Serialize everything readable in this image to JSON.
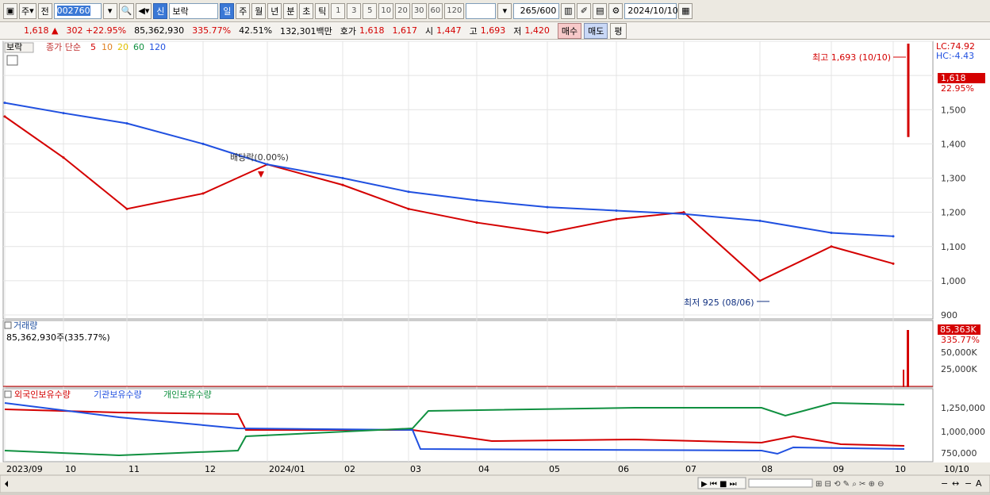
{
  "toolbar": {
    "period_select": "주",
    "prev_label": "전",
    "code": "002760",
    "market_badge": "신",
    "stock_name": "보락",
    "period_tabs": [
      "일",
      "주",
      "월",
      "년",
      "분",
      "초",
      "틱"
    ],
    "interval_buttons": [
      "1",
      "3",
      "5",
      "10",
      "20",
      "30",
      "60",
      "120"
    ],
    "view_count": "265",
    "view_total": "/600",
    "date": "2024/10/10"
  },
  "quote": {
    "price": "1,618",
    "arrow": "▲",
    "change": "302",
    "change_pct": "+22.95%",
    "volume": "85,362,930",
    "volume_pct": "335.77%",
    "turnover": "42.51%",
    "amount": "132,301백만",
    "bid_ask_label": "호가",
    "ask": "1,618",
    "bid": "1,617",
    "open_label": "시",
    "open": "1,447",
    "high_label": "고",
    "high": "1,693",
    "low_label": "저",
    "low": "1,420",
    "buy_button": "매수",
    "sell_button": "매도",
    "eval_button": "평"
  },
  "price_panel": {
    "legend_name": "보락",
    "legend_ma": "종가 단순",
    "ma_periods": [
      "5",
      "10",
      "20",
      "60",
      "120"
    ],
    "ma_colors": [
      "#d40000",
      "#e08020",
      "#f0e000",
      "#109040",
      "#2050e0"
    ],
    "lc": "LC:74.92",
    "hc": "HC:-4.43",
    "current_price": "1,618",
    "current_pct": "22.95%",
    "high_note": "최고 1,693 (10/10)",
    "low_note": "최저 925 (08/06)",
    "dividend_note": "배당락(0.00%)",
    "y_ticks": [
      "1,500",
      "1,400",
      "1,300",
      "1,200",
      "1,100",
      "1,000",
      "900"
    ]
  },
  "volume_panel": {
    "title": "거래량",
    "value_text": "85,362,930주(335.77%)",
    "current": "85,363K",
    "current_pct": "335.77%",
    "y_ticks": [
      "50,000K",
      "25,000K"
    ]
  },
  "holdings_panel": {
    "legend": [
      "외국인보유수량",
      "기관보유수량",
      "개인보유수량"
    ],
    "colors": [
      "#d40000",
      "#2050e0",
      "#109040"
    ],
    "y_ticks": [
      "1,250,000",
      "1,000,000",
      "750,000"
    ]
  },
  "x_axis": {
    "labels": [
      "2023/09",
      "10",
      "11",
      "12",
      "2024/01",
      "02",
      "03",
      "04",
      "05",
      "06",
      "07",
      "08",
      "09",
      "10"
    ],
    "right_label": "10/10"
  },
  "chart_data": {
    "type": "line",
    "title": "보락",
    "x": [
      "2023/09",
      "10",
      "11",
      "12",
      "2024/01",
      "02",
      "03",
      "04",
      "05",
      "06",
      "07",
      "08",
      "09",
      "10"
    ],
    "series": [
      {
        "name": "5",
        "values": [
          1480,
          1360,
          1210,
          1255,
          1340,
          1280,
          1210,
          1170,
          1140,
          1180,
          1200,
          1000,
          1100,
          1050
        ]
      },
      {
        "name": "120",
        "values": [
          1520,
          1490,
          1460,
          1400,
          1340,
          1300,
          1260,
          1235,
          1215,
          1205,
          1195,
          1175,
          1140,
          1130
        ]
      }
    ],
    "ylim": [
      900,
      1700
    ]
  }
}
